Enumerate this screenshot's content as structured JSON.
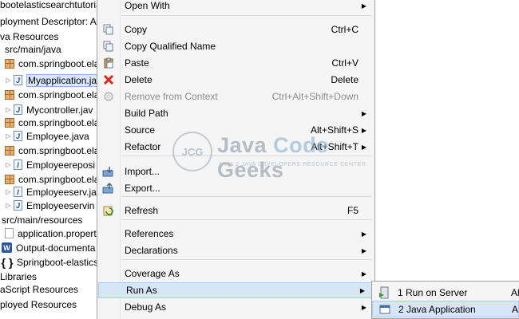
{
  "tree": {
    "items": [
      {
        "text": "bootelasticsearchtutoria",
        "icon": "none",
        "twisty": ""
      },
      {
        "text": "ployment Descriptor: Ar",
        "icon": "none",
        "twisty": ""
      },
      {
        "text": "va Resources",
        "icon": "none",
        "twisty": ""
      },
      {
        "text": "src/main/java",
        "icon": "none",
        "twisty": ""
      },
      {
        "text": "com.springboot.ela",
        "icon": "package-icon",
        "twisty": ""
      },
      {
        "text": "Myapplication.ja",
        "icon": "java-file-icon",
        "twisty": "▷",
        "selected": true
      },
      {
        "text": "com.springboot.ela",
        "icon": "package-icon",
        "twisty": ""
      },
      {
        "text": "Mycontroller.jav",
        "icon": "java-file-icon",
        "twisty": "▷"
      },
      {
        "text": "com.springboot.ela",
        "icon": "package-icon",
        "twisty": ""
      },
      {
        "text": "Employee.java",
        "icon": "java-file-icon",
        "twisty": "▷"
      },
      {
        "text": "com.springboot.ela",
        "icon": "package-icon",
        "twisty": ""
      },
      {
        "text": "Employeereposi",
        "icon": "java-interface-icon",
        "twisty": "▷"
      },
      {
        "text": "com.springboot.ela",
        "icon": "package-icon",
        "twisty": ""
      },
      {
        "text": "Employeeserv.ja",
        "icon": "java-interface-icon",
        "twisty": "▷"
      },
      {
        "text": "Employeeservin",
        "icon": "java-file-icon",
        "twisty": "▷"
      },
      {
        "text": "src/main/resources",
        "icon": "none",
        "twisty": ""
      },
      {
        "text": "application.propert",
        "icon": "file-icon",
        "twisty": ""
      },
      {
        "text": "Output-documenta",
        "icon": "word-doc-icon",
        "twisty": ""
      },
      {
        "text": "Springboot-elastics",
        "icon": "json-icon",
        "twisty": ""
      },
      {
        "text": "Libraries",
        "icon": "none",
        "twisty": ""
      },
      {
        "text": "aScript Resources",
        "icon": "none",
        "twisty": ""
      },
      {
        "text": "ployed Resources",
        "icon": "none",
        "twisty": ""
      }
    ]
  },
  "menu": {
    "items": [
      {
        "label": "Open With",
        "shortcut": "",
        "submenu": true,
        "icon": ""
      },
      {
        "label": "Copy",
        "shortcut": "Ctrl+C",
        "submenu": false,
        "icon": "copy-icon"
      },
      {
        "label": "Copy Qualified Name",
        "shortcut": "",
        "submenu": false,
        "icon": "copy-qualified-icon"
      },
      {
        "label": "Paste",
        "shortcut": "Ctrl+V",
        "submenu": false,
        "icon": "paste-icon"
      },
      {
        "label": "Delete",
        "shortcut": "Delete",
        "submenu": false,
        "icon": "delete-icon"
      },
      {
        "label": "Remove from Context",
        "shortcut": "Ctrl+Alt+Shift+Down",
        "submenu": false,
        "icon": "remove-context-icon",
        "disabled": true
      },
      {
        "label": "Build Path",
        "shortcut": "",
        "submenu": true,
        "icon": ""
      },
      {
        "label": "Source",
        "shortcut": "Alt+Shift+S",
        "submenu": true,
        "icon": ""
      },
      {
        "label": "Refactor",
        "shortcut": "Alt+Shift+T",
        "submenu": true,
        "icon": ""
      },
      {
        "label": "Import...",
        "shortcut": "",
        "submenu": false,
        "icon": "import-icon"
      },
      {
        "label": "Export...",
        "shortcut": "",
        "submenu": false,
        "icon": "export-icon"
      },
      {
        "label": "Refresh",
        "shortcut": "F5",
        "submenu": false,
        "icon": "refresh-icon"
      },
      {
        "label": "References",
        "shortcut": "",
        "submenu": true,
        "icon": ""
      },
      {
        "label": "Declarations",
        "shortcut": "",
        "submenu": true,
        "icon": ""
      },
      {
        "label": "Coverage As",
        "shortcut": "",
        "submenu": true,
        "icon": ""
      },
      {
        "label": "Run As",
        "shortcut": "",
        "submenu": true,
        "icon": "",
        "highlighted": true
      },
      {
        "label": "Debug As",
        "shortcut": "",
        "submenu": true,
        "icon": ""
      }
    ]
  },
  "submenu": {
    "items": [
      {
        "label": "1 Run on Server",
        "shortcut": "Al",
        "icon": "run-on-server-icon"
      },
      {
        "label": "2 Java Application",
        "shortcut": "A",
        "icon": "java-application-icon",
        "highlighted": true
      }
    ]
  },
  "watermark": {
    "logo_text": "JCG",
    "title_part1": "Java ",
    "title_part2": "Code",
    "title_part3": " Geeks",
    "subtitle": "JAVA 2 JAVA DEVELOPERS RESOURCE CENTER"
  }
}
